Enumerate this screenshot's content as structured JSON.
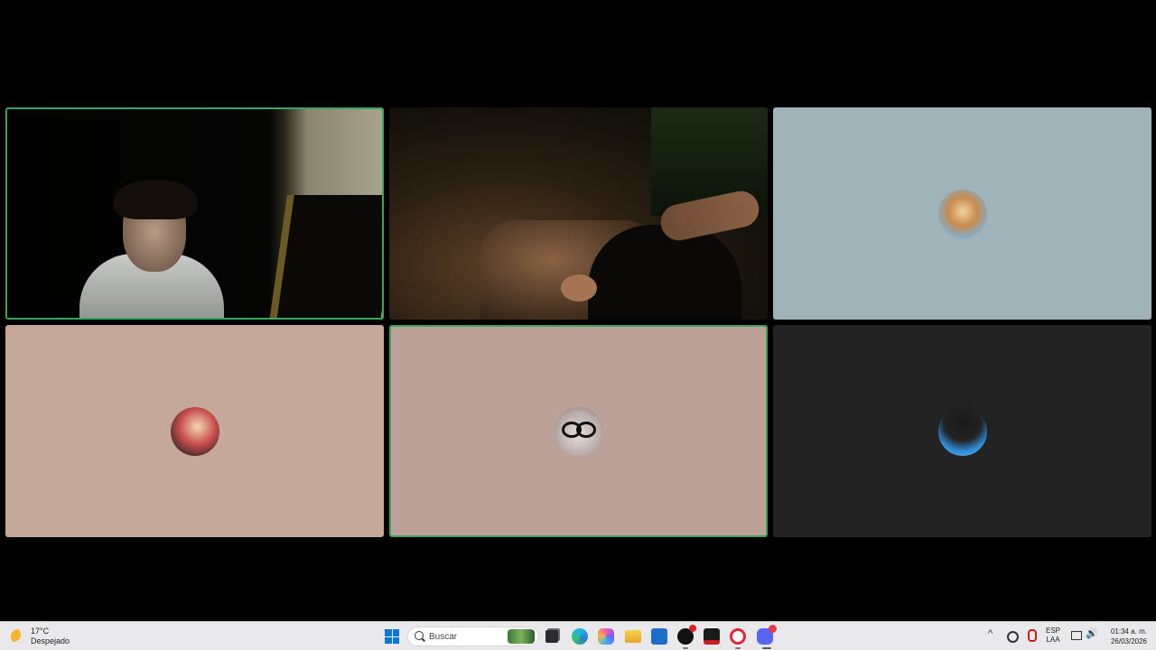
{
  "call": {
    "participants": [
      {
        "type": "camera",
        "speaking": true
      },
      {
        "type": "camera",
        "speaking": false
      },
      {
        "type": "avatar",
        "avatar_icon": "bird-avatar",
        "tile_color": "#9fb3b9",
        "speaking": false
      },
      {
        "type": "avatar",
        "avatar_icon": "couple-avatar",
        "tile_color": "#c6a89b",
        "speaking": false
      },
      {
        "type": "avatar",
        "avatar_icon": "cat-glasses-avatar",
        "tile_color": "#bba197",
        "speaking": true
      },
      {
        "type": "avatar",
        "avatar_icon": "whale-avatar",
        "tile_color": "#232323",
        "speaking": false
      }
    ],
    "speaking_ring_color": "#3ba55c"
  },
  "taskbar": {
    "weather": {
      "temperature": "17°C",
      "condition": "Despejado",
      "icon": "moon-icon"
    },
    "search": {
      "placeholder": "Buscar"
    },
    "pinned_apps": [
      "start-icon",
      "task-view-icon",
      "edge-icon",
      "copilot-icon",
      "file-explorer-icon",
      "store-icon",
      "steam-icon",
      "voicemeeter-icon",
      "opera-gx-icon",
      "discord-icon"
    ],
    "language": {
      "line1": "ESP",
      "line2": "LAA"
    },
    "clock": {
      "time": "01:34 a. m.",
      "date": "26/03/2026"
    }
  }
}
